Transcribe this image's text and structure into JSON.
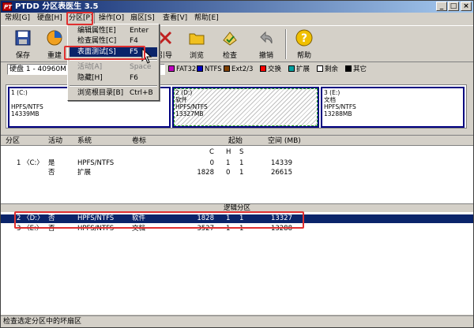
{
  "app": {
    "title": "PTDD 分区表医生 3.5",
    "icon_text": "PT"
  },
  "window_buttons": {
    "minimize": "_",
    "maximize": "□",
    "close": "×"
  },
  "menubar": [
    {
      "label": "常规[G]"
    },
    {
      "label": "硬盘[H]"
    },
    {
      "label": "分区[P]"
    },
    {
      "label": "操作[O]"
    },
    {
      "label": "扇区[S]"
    },
    {
      "label": "查看[V]"
    },
    {
      "label": "帮助[E]"
    }
  ],
  "toolbar": [
    {
      "label": "保存",
      "icon": "floppy-icon"
    },
    {
      "label": "重建",
      "icon": "rebuild-icon"
    },
    {
      "label": "引导",
      "icon": "boot-icon"
    },
    {
      "label": "浏览",
      "icon": "folder-icon"
    },
    {
      "label": "检查",
      "icon": "check-icon"
    },
    {
      "label": "撤销",
      "icon": "undo-icon"
    },
    {
      "label": "帮助",
      "icon": "help-icon"
    }
  ],
  "disk_select": {
    "value": "硬盘 1 - 40960M"
  },
  "legend": [
    {
      "label": "FAT32",
      "color": "#c000c0"
    },
    {
      "label": "NTFS",
      "color": "#0000c0"
    },
    {
      "label": "Ext2/3",
      "color": "#804000"
    },
    {
      "label": "交换",
      "color": "#ff0000"
    },
    {
      "label": "扩展",
      "color": "#00a0a0"
    },
    {
      "label": "剩余",
      "color": "#ffffff"
    },
    {
      "label": "其它",
      "color": "#000000"
    }
  ],
  "partition_map": [
    {
      "l1": "1 (C:)",
      "l2": "",
      "l3": "HPFS/NTFS",
      "l4": "14339MB"
    },
    {
      "l1": "2 (D:)",
      "l2": "软件",
      "l3": "HPFS/NTFS",
      "l4": "13327MB"
    },
    {
      "l1": "3 (E:)",
      "l2": "文档",
      "l3": "HPFS/NTFS",
      "l4": "13288MB"
    }
  ],
  "list_headers": {
    "partition": "分区",
    "active": "活动",
    "system": "系统",
    "label": "卷标",
    "start": "起始",
    "size": "空间 (MB)"
  },
  "chs_headers": {
    "c": "C",
    "h": "H",
    "s": "S"
  },
  "rows": [
    {
      "part": "1 〈C:〉",
      "active": "是",
      "system": "HPFS/NTFS",
      "label": "",
      "c": "0",
      "h": "1",
      "s": "1",
      "size": "14339"
    },
    {
      "part": "",
      "active": "否",
      "system": "扩展",
      "label": "",
      "c": "1828",
      "h": "0",
      "s": "1",
      "size": "26615"
    }
  ],
  "logical_label": "逻辑分区",
  "logical_rows": [
    {
      "part": "2 〈D:〉",
      "active": "否",
      "system": "HPFS/NTFS",
      "label": "软件",
      "c": "1828",
      "h": "1",
      "s": "1",
      "size": "13327"
    },
    {
      "part": "3 〈E:〉",
      "active": "否",
      "system": "HPFS/NTFS",
      "label": "文档",
      "c": "3527",
      "h": "1",
      "s": "1",
      "size": "13288"
    }
  ],
  "status": "检查选定分区中的坏扇区",
  "dropdown": [
    {
      "label": "编辑属性[E]",
      "shortcut": "Enter",
      "disabled": false
    },
    {
      "label": "检查属性[C]",
      "shortcut": "F4",
      "disabled": false
    },
    {
      "label": "表面测试[S]",
      "shortcut": "F5",
      "disabled": false
    },
    {
      "label": "活动[A]",
      "shortcut": "Space",
      "disabled": true
    },
    {
      "label": "隐藏[H]",
      "shortcut": "F6",
      "disabled": false
    },
    {
      "label": "浏览根目录[B]",
      "shortcut": "Ctrl+B",
      "disabled": false
    }
  ],
  "colors": {
    "title_start": "#0a246a",
    "title_end": "#a6caf0",
    "highlight": "#0a246a",
    "annotation": "#e03030"
  }
}
